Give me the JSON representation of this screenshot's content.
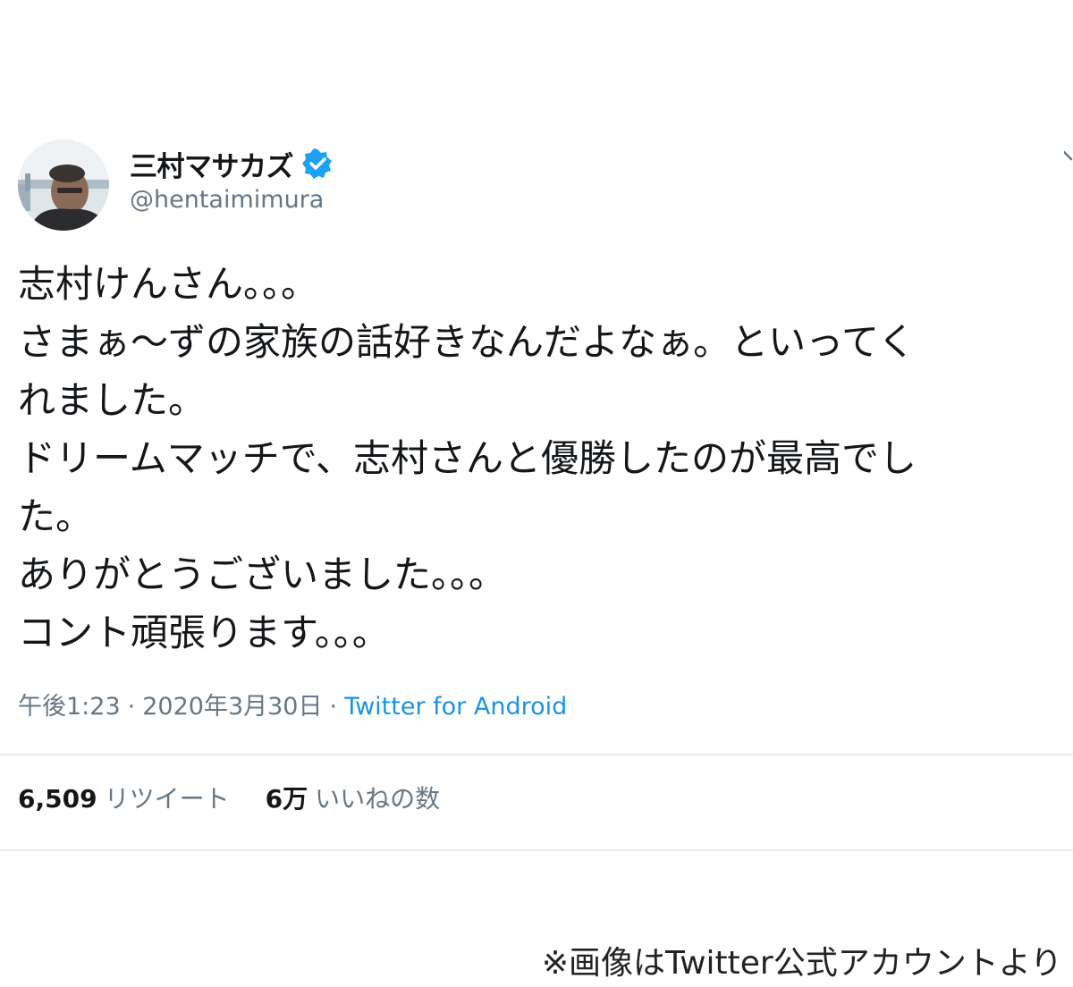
{
  "user": {
    "display_name": "三村マサカズ",
    "handle": "@hentaimimura",
    "avatar_icon": "user-avatar-photo",
    "verified_icon": "verified-badge-icon"
  },
  "tweet": {
    "lines": [
      "志村けんさん。。。",
      "さまぁ〜ずの家族の話好きなんだよなぁ。といってく",
      "れました。",
      "ドリームマッチで、志村さんと優勝したのが最高でし",
      "た。",
      "ありがとうございました。。。",
      "コント頑張ります。。。"
    ]
  },
  "meta": {
    "time": "午後1:23",
    "separator": "·",
    "date": "2020年3月30日",
    "source": "Twitter for Android"
  },
  "stats": {
    "retweets_count": "6,509",
    "retweets_label": "リツイート",
    "likes_count": "6万",
    "likes_label": "いいねの数"
  },
  "credit": "※画像はTwitter公式アカウントより",
  "colors": {
    "accent": "#1b95e0",
    "verified": "#1da1f2",
    "muted": "#657786",
    "text": "#14171a",
    "divider": "#e6ecf0"
  }
}
